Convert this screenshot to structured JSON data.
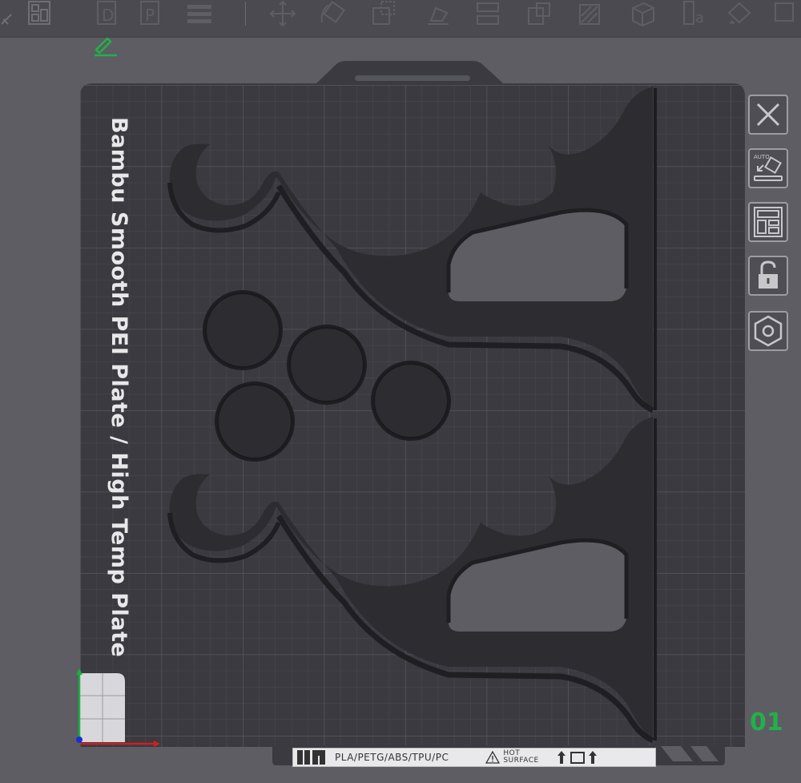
{
  "plate": {
    "label": "Bambu Smooth PEI Plate / High Temp Plate",
    "number": "01"
  },
  "bottom_strip": {
    "materials": "PLA/PETG/ABS/TPU/PC",
    "warning_line1": "HOT",
    "warning_line2": "SURFACE"
  },
  "side_toolbar": {
    "auto_label": "AUTO"
  },
  "colors": {
    "background": "#5d5d63",
    "plate": "#3a3a40",
    "parts": "#2c2c31",
    "accent_green": "#22b04a"
  }
}
